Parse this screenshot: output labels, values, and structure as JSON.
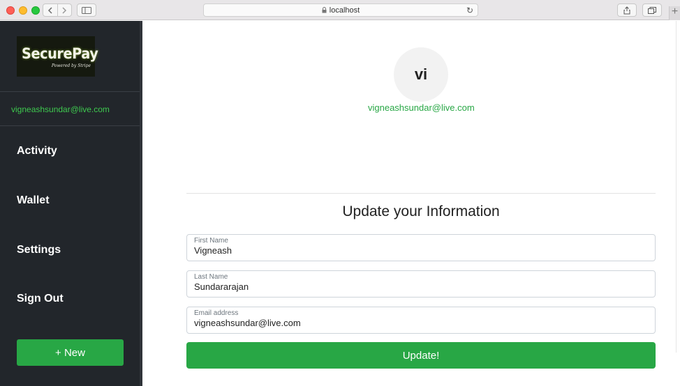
{
  "browser": {
    "url": "localhost"
  },
  "sidebar": {
    "logo": {
      "main": "SecurePay",
      "sub": "Powered by Stripe"
    },
    "user_email": "vigneashsundar@live.com",
    "items": [
      {
        "label": "Activity"
      },
      {
        "label": "Wallet"
      },
      {
        "label": "Settings"
      },
      {
        "label": "Sign Out"
      }
    ],
    "new_button": "+ New"
  },
  "profile": {
    "initials": "vi",
    "email": "vigneashsundar@live.com"
  },
  "form": {
    "title": "Update your Information",
    "fields": [
      {
        "label": "First Name",
        "value": "Vigneash"
      },
      {
        "label": "Last Name",
        "value": "Sundararajan"
      },
      {
        "label": "Email address",
        "value": "vigneashsundar@live.com"
      }
    ],
    "submit": "Update!"
  },
  "colors": {
    "accent": "#28a745",
    "sidebar_bg": "#22262b",
    "sidebar_email": "#3ec94f"
  }
}
